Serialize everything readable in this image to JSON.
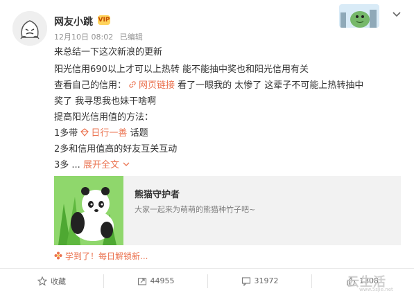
{
  "post": {
    "author": "网友小跳",
    "vip_badge": "VIP",
    "time": "12月10日 08:02",
    "edited": "已编辑",
    "lines": {
      "l1": "来总结一下这次新浪的更新",
      "l2": "阳光信用690以上才可以上热转 能不能抽中奖也和阳光信用有关",
      "l3_prefix": "查看自己的信用：",
      "l3_link": "网页链接",
      "l3_suffix": " 看了一眼我的 太惨了 这辈子不可能上热转抽中",
      "l4": "奖了 我寻思我也妹干啥啊",
      "l5": "提高阳光信用值的方法：",
      "l6_prefix": "1多带",
      "l6_topic": "日行一善",
      "l6_suffix": " 话题",
      "l7": "2多和信用值高的好友互关互动",
      "l8_prefix": "3多 ... ",
      "l8_more": "展开全文"
    }
  },
  "share_card": {
    "title": "熊猫守护者",
    "description": "大家一起来为萌萌的熊猫种竹子吧~"
  },
  "learned": "学到了！每日解锁新...",
  "actions": {
    "favorite": "收藏",
    "repost_count": "44955",
    "comment_count": "31972",
    "like_count": "1308"
  },
  "watermark": {
    "main": "云生活",
    "sub": "www.5sjie.net"
  },
  "colors": {
    "accent": "#eb7350",
    "meta_gray": "#939393",
    "card_bg": "#f2f2f2"
  }
}
